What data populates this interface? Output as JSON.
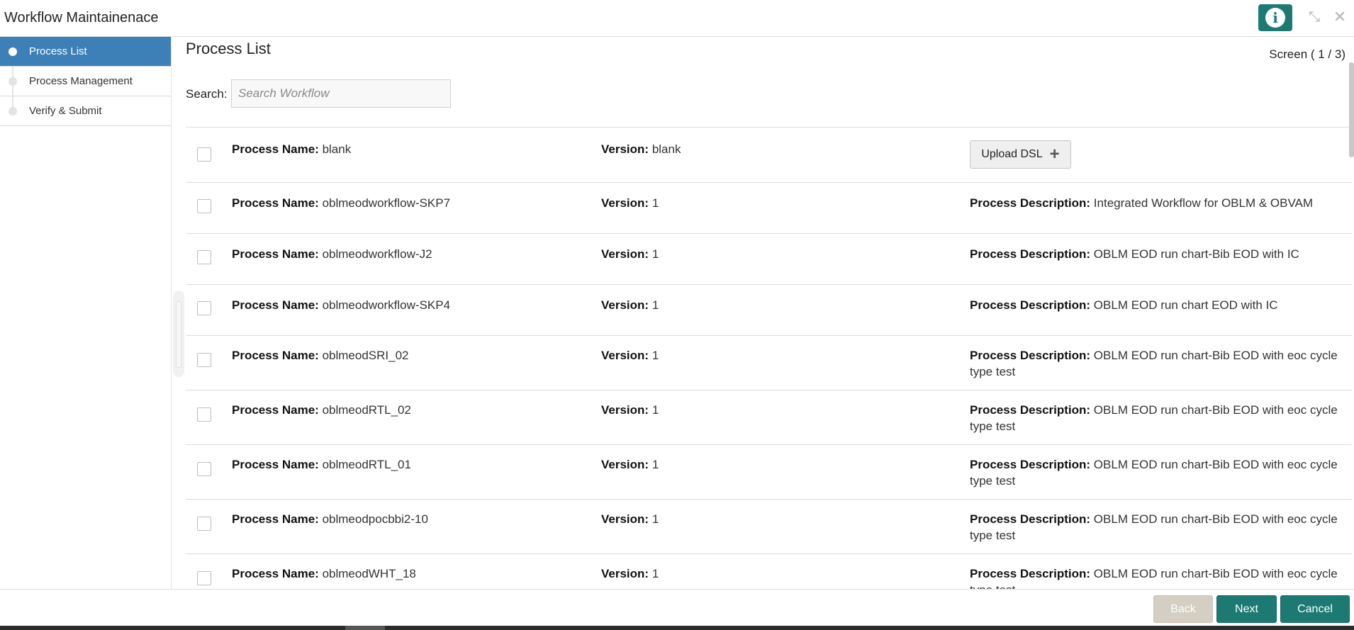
{
  "window": {
    "title": "Workflow Maintainenace",
    "info_label": "i",
    "minimize_glyph": "⤡",
    "close_glyph": "✕"
  },
  "sidebar": {
    "items": [
      {
        "label": "Process List",
        "active": true
      },
      {
        "label": "Process Management",
        "active": false
      },
      {
        "label": "Verify & Submit",
        "active": false
      }
    ]
  },
  "main": {
    "title": "Process List",
    "screen_counter": "Screen ( 1 / 3)",
    "search": {
      "label": "Search:",
      "placeholder": "Search Workflow",
      "value": ""
    },
    "labels": {
      "name": "Process Name:",
      "version": "Version:",
      "description": "Process Description:"
    },
    "upload_button": "Upload DSL",
    "rows": [
      {
        "name": "blank",
        "version": "blank",
        "description": null,
        "checked": false
      },
      {
        "name": "oblmeodworkflow-SKP7",
        "version": "1",
        "description": "Integrated Workflow for OBLM & OBVAM",
        "checked": false
      },
      {
        "name": "oblmeodworkflow-J2",
        "version": "1",
        "description": "OBLM EOD run chart-Bib EOD with IC",
        "checked": false
      },
      {
        "name": "oblmeodworkflow-SKP4",
        "version": "1",
        "description": "OBLM EOD run chart EOD with IC",
        "checked": false
      },
      {
        "name": "oblmeodSRI_02",
        "version": "1",
        "description": "OBLM EOD run chart-Bib EOD with eoc cycle type test",
        "checked": false
      },
      {
        "name": "oblmeodRTL_02",
        "version": "1",
        "description": "OBLM EOD run chart-Bib EOD with eoc cycle type test",
        "checked": false
      },
      {
        "name": "oblmeodRTL_01",
        "version": "1",
        "description": "OBLM EOD run chart-Bib EOD with eoc cycle type test",
        "checked": false
      },
      {
        "name": "oblmeodpocbbi2-10",
        "version": "1",
        "description": "OBLM EOD run chart-Bib EOD with eoc cycle type test",
        "checked": false
      },
      {
        "name": "oblmeodWHT_18",
        "version": "1",
        "description": "OBLM EOD run chart-Bib EOD with eoc cycle type test",
        "checked": false
      }
    ]
  },
  "footer": {
    "back_label": "Back",
    "next_label": "Next",
    "cancel_label": "Cancel"
  },
  "colors": {
    "accent": "#1c7a72",
    "sidebar_active": "#3d7fb7",
    "back_disabled": "#d4cfc2"
  },
  "icons": {
    "info": "info-icon",
    "minimize": "minimize-icon",
    "close": "close-icon",
    "plus": "plus-icon"
  }
}
